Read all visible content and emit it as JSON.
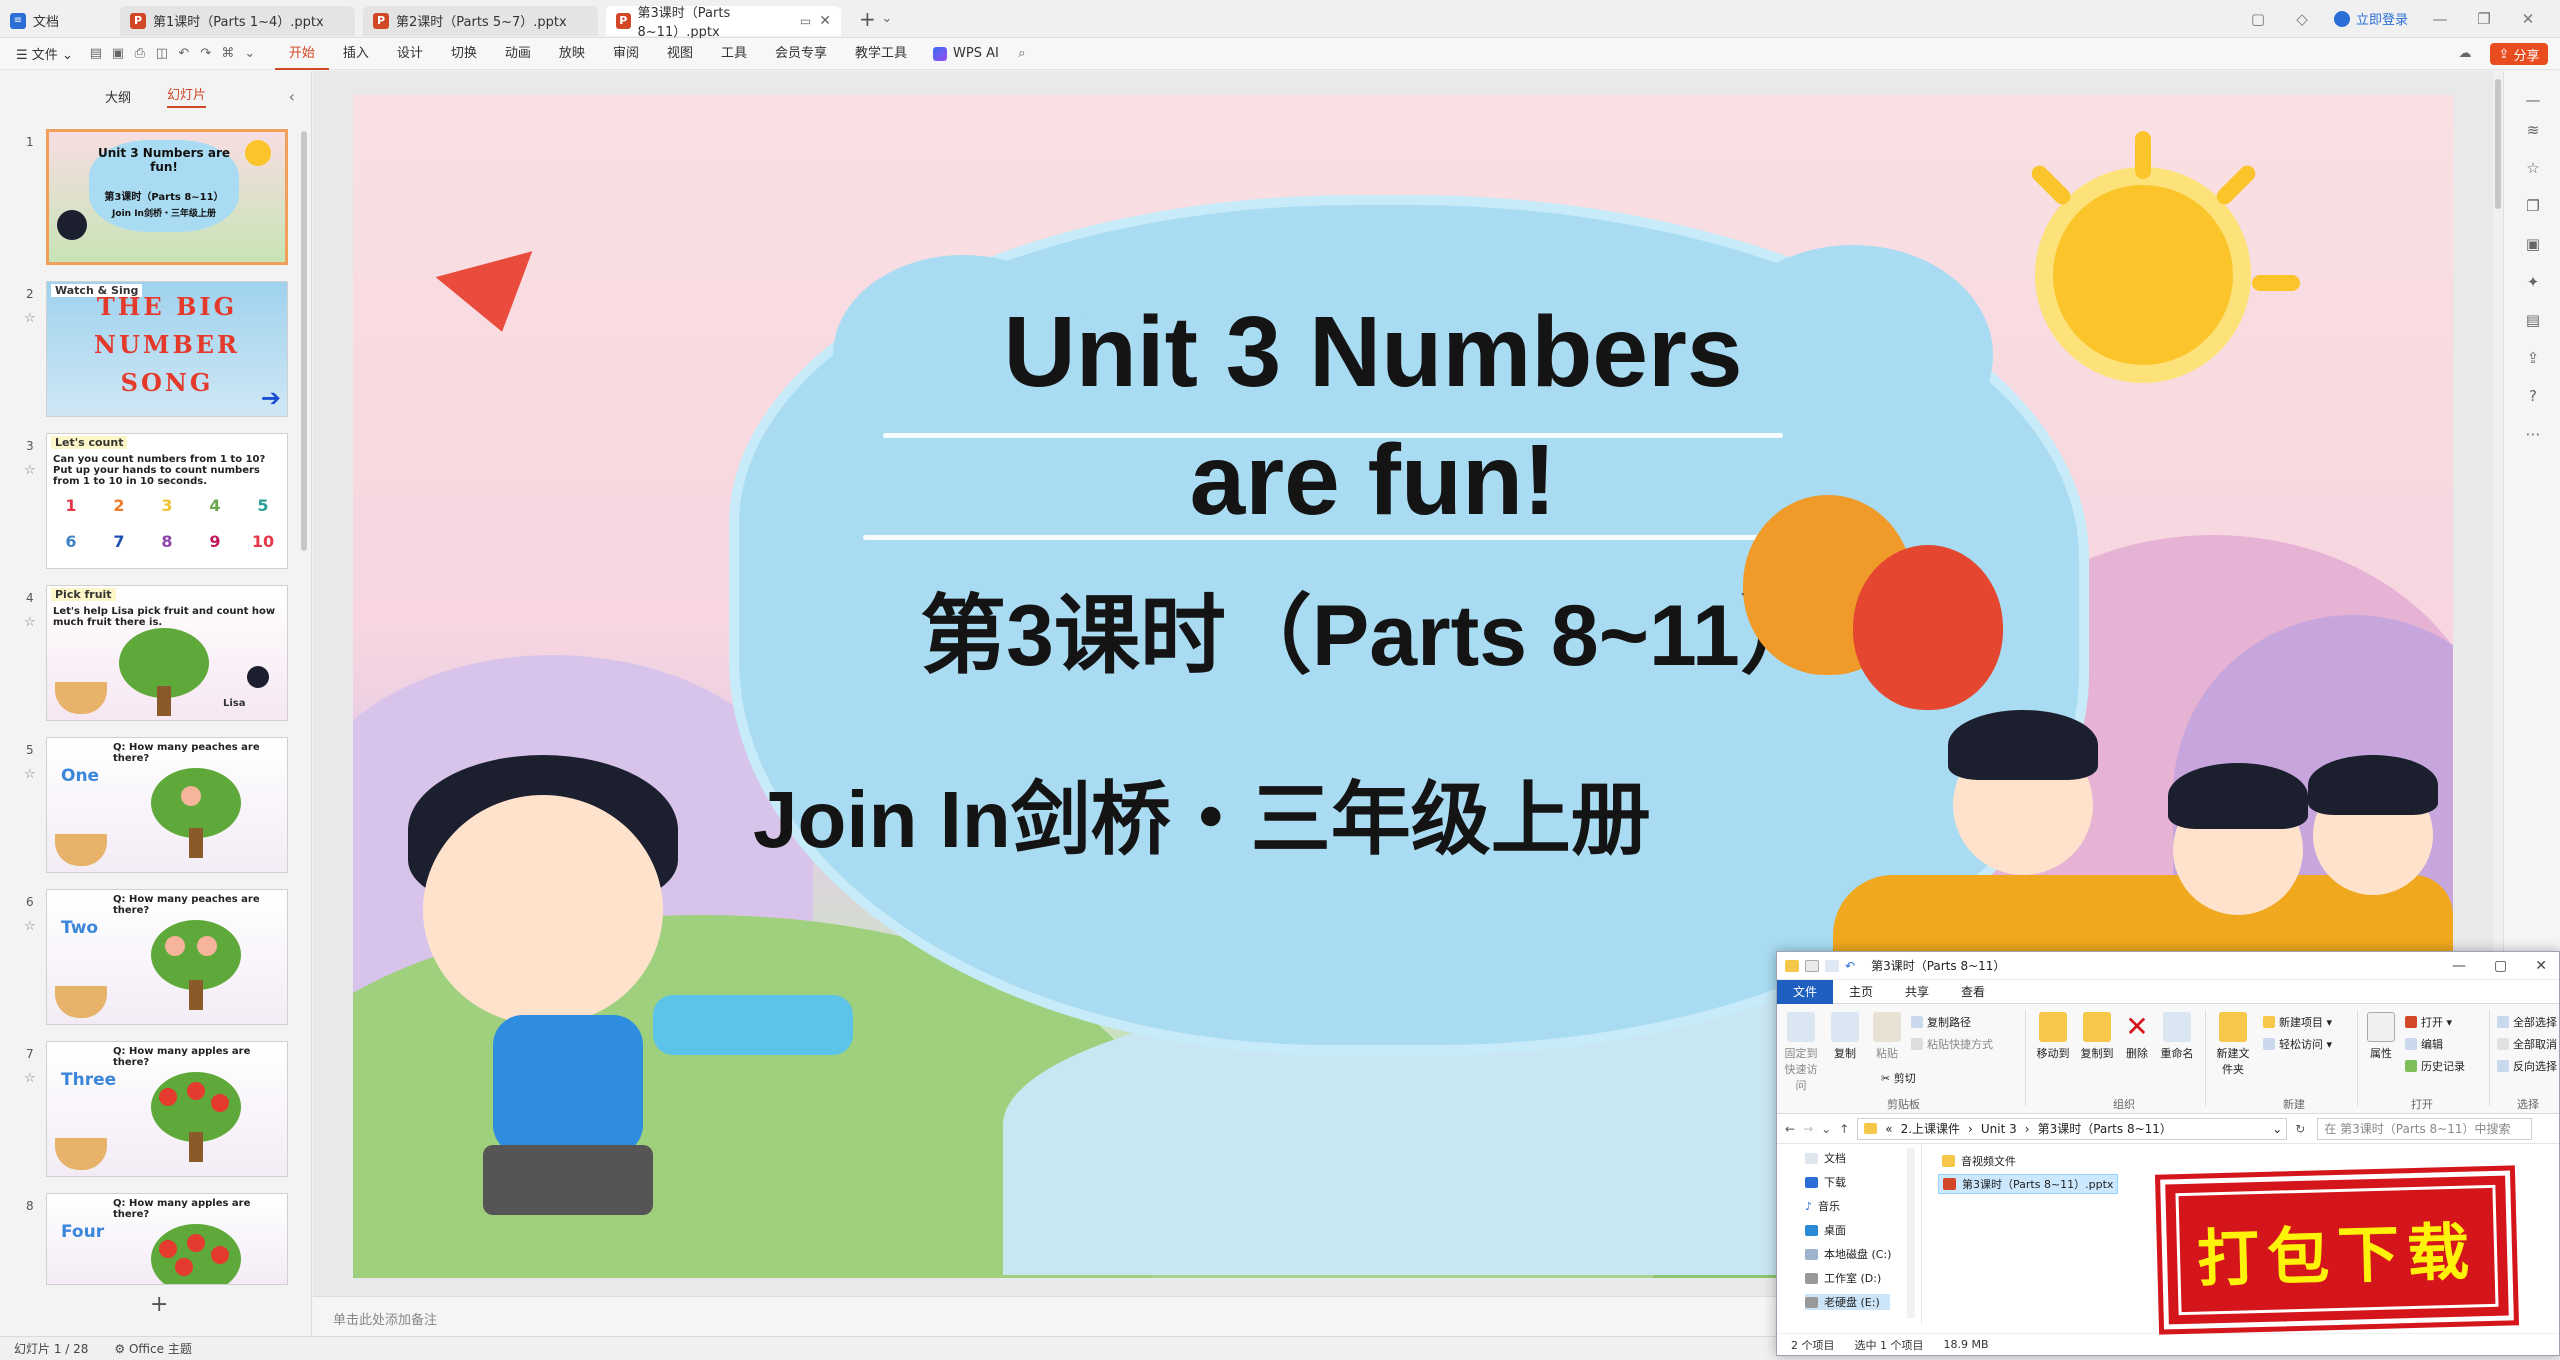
{
  "tabs": [
    {
      "label": "文档",
      "kind": "home"
    },
    {
      "label": "第1课时（Parts 1~4）.pptx",
      "kind": "ppt"
    },
    {
      "label": "第2课时（Parts 5~7）.pptx",
      "kind": "ppt"
    },
    {
      "label": "第3课时（Parts 8~11）.pptx",
      "kind": "ppt",
      "active": true
    }
  ],
  "titlebar": {
    "login_label": "立即登录"
  },
  "menubar": {
    "file_label": "文件",
    "menus": [
      "开始",
      "插入",
      "设计",
      "切换",
      "动画",
      "放映",
      "审阅",
      "视图",
      "工具",
      "会员专享",
      "教学工具"
    ],
    "active_menu": "开始",
    "wps_ai_label": "WPS AI",
    "share_label": "分享"
  },
  "left_panel": {
    "tab_outline": "大纲",
    "tab_slides": "幻灯片",
    "slides": [
      {
        "num": "1",
        "title": "Unit 3 Numbers are fun!",
        "sub": "第3课时（Parts 8~11）",
        "series": "Join In剑桥・三年级上册"
      },
      {
        "num": "2",
        "label": "Watch & Sing",
        "title": "THE BIG NUMBER SONG"
      },
      {
        "num": "3",
        "label": "Let's count",
        "text": "Can you count numbers from 1 to 10? Put up your hands to count numbers from 1 to 10 in 10 seconds.",
        "numbers": [
          "1",
          "2",
          "3",
          "4",
          "5",
          "6",
          "7",
          "8",
          "9",
          "10"
        ]
      },
      {
        "num": "4",
        "label": "Pick fruit",
        "text": "Let's help Lisa pick fruit and count how much fruit there is.",
        "name": "Lisa"
      },
      {
        "num": "5",
        "question": "Q: How many peaches are there?",
        "word": "One"
      },
      {
        "num": "6",
        "question": "Q: How many peaches are there?",
        "word": "Two"
      },
      {
        "num": "7",
        "question": "Q: How many apples are there?",
        "word": "Three"
      },
      {
        "num": "8",
        "question": "Q: How many apples are there?",
        "word": "Four"
      }
    ]
  },
  "slide": {
    "title_line1": "Unit 3 Numbers",
    "title_line2": "are fun!",
    "subtitle": "第3课时（Parts 8~11）",
    "series": "Join In剑桥・三年级上册"
  },
  "notes_placeholder": "单击此处添加备注",
  "statusbar": {
    "slide_counter": "幻灯片 1 / 28",
    "theme": "Office 主题"
  },
  "explorer": {
    "title": "第3课时（Parts 8~11）",
    "tabs": [
      "文件",
      "主页",
      "共享",
      "查看"
    ],
    "ribbon": {
      "pin": "固定到快速访问",
      "copy": "复制",
      "paste": "粘贴",
      "copy_path": "复制路径",
      "paste_shortcut": "粘贴快捷方式",
      "cut": "剪切",
      "group_clipboard": "剪贴板",
      "move_to": "移动到",
      "copy_to": "复制到",
      "delete": "删除",
      "rename": "重命名",
      "group_organize": "组织",
      "new_folder": "新建文件夹",
      "new_item": "新建项目",
      "easy_access": "轻松访问",
      "group_new": "新建",
      "properties": "属性",
      "open": "打开",
      "edit": "编辑",
      "history": "历史记录",
      "group_open": "打开",
      "select_all": "全部选择",
      "select_none": "全部取消",
      "invert": "反向选择",
      "group_select": "选择"
    },
    "path": [
      "2.上课课件",
      "Unit 3",
      "第3课时（Parts 8~11）"
    ],
    "search_placeholder": "在 第3课时（Parts 8~11）中搜索",
    "nav": [
      "文档",
      "下载",
      "音乐",
      "桌面",
      "本地磁盘 (C:)",
      "工作室 (D:)",
      "老硬盘 (E:)"
    ],
    "files": [
      {
        "name": "音视频文件",
        "type": "folder"
      },
      {
        "name": "第3课时（Parts 8~11）.pptx",
        "type": "pptx",
        "selected": true
      }
    ],
    "status_count": "2 个项目",
    "status_selected": "选中 1 个项目",
    "status_size": "18.9 MB"
  },
  "stamp_text": "打包下载"
}
